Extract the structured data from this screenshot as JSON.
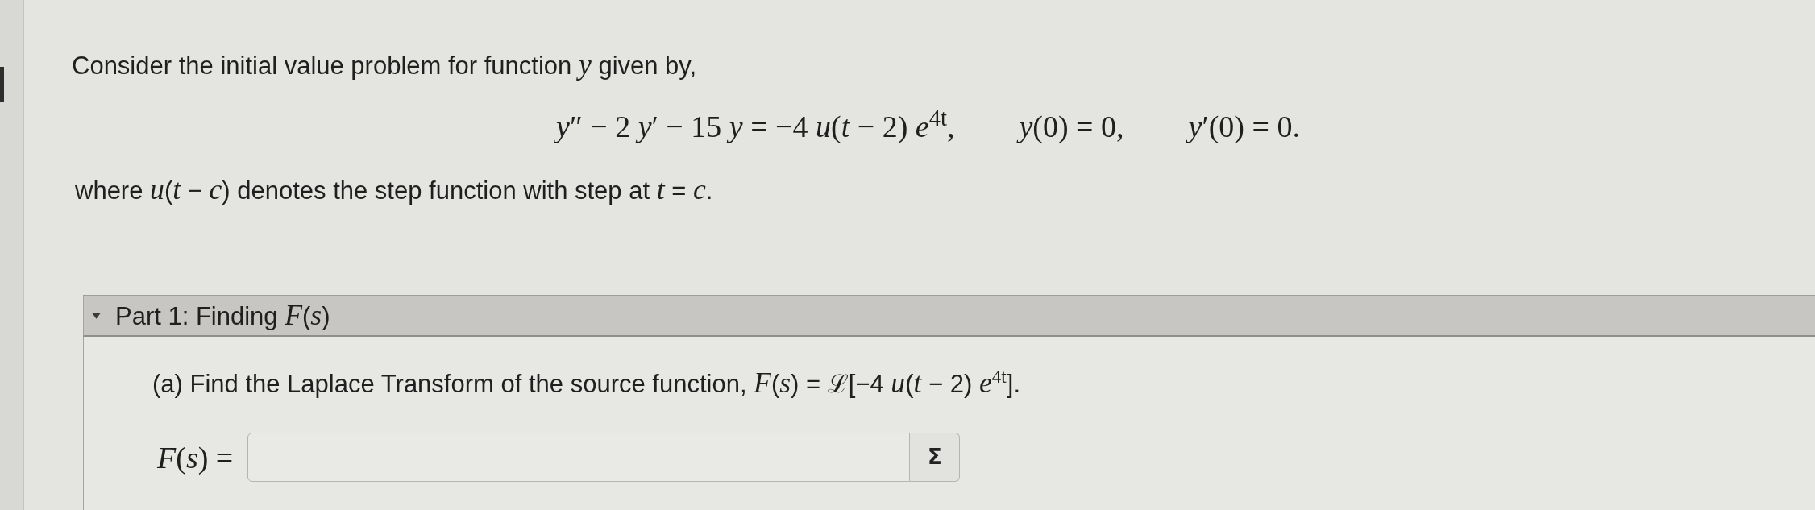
{
  "problem": {
    "intro": "Consider the initial value problem for function *y* given by,",
    "equations": [
      "*y*″ − 2 *y*′ − 15 *y* = −4 *u*(*t* − 2) *e*$^{4t}$,",
      "*y*(0) = 0,",
      "*y*′(0) = 0."
    ],
    "note": "where *u*(*t* − *c*) denotes the step function with step at *t* = *c*."
  },
  "parts": [
    {
      "title": "Part 1: Finding *F*(*s*)",
      "expanded": true,
      "question": "(a) Find the Laplace Transform of the source function, *F*(*s*) = ℒ[−4 *u*(*t* − 2) *e*$^{4t}$].",
      "answer": {
        "label": "*F*(*s*) =",
        "symbol_button": "Σ"
      }
    }
  ]
}
